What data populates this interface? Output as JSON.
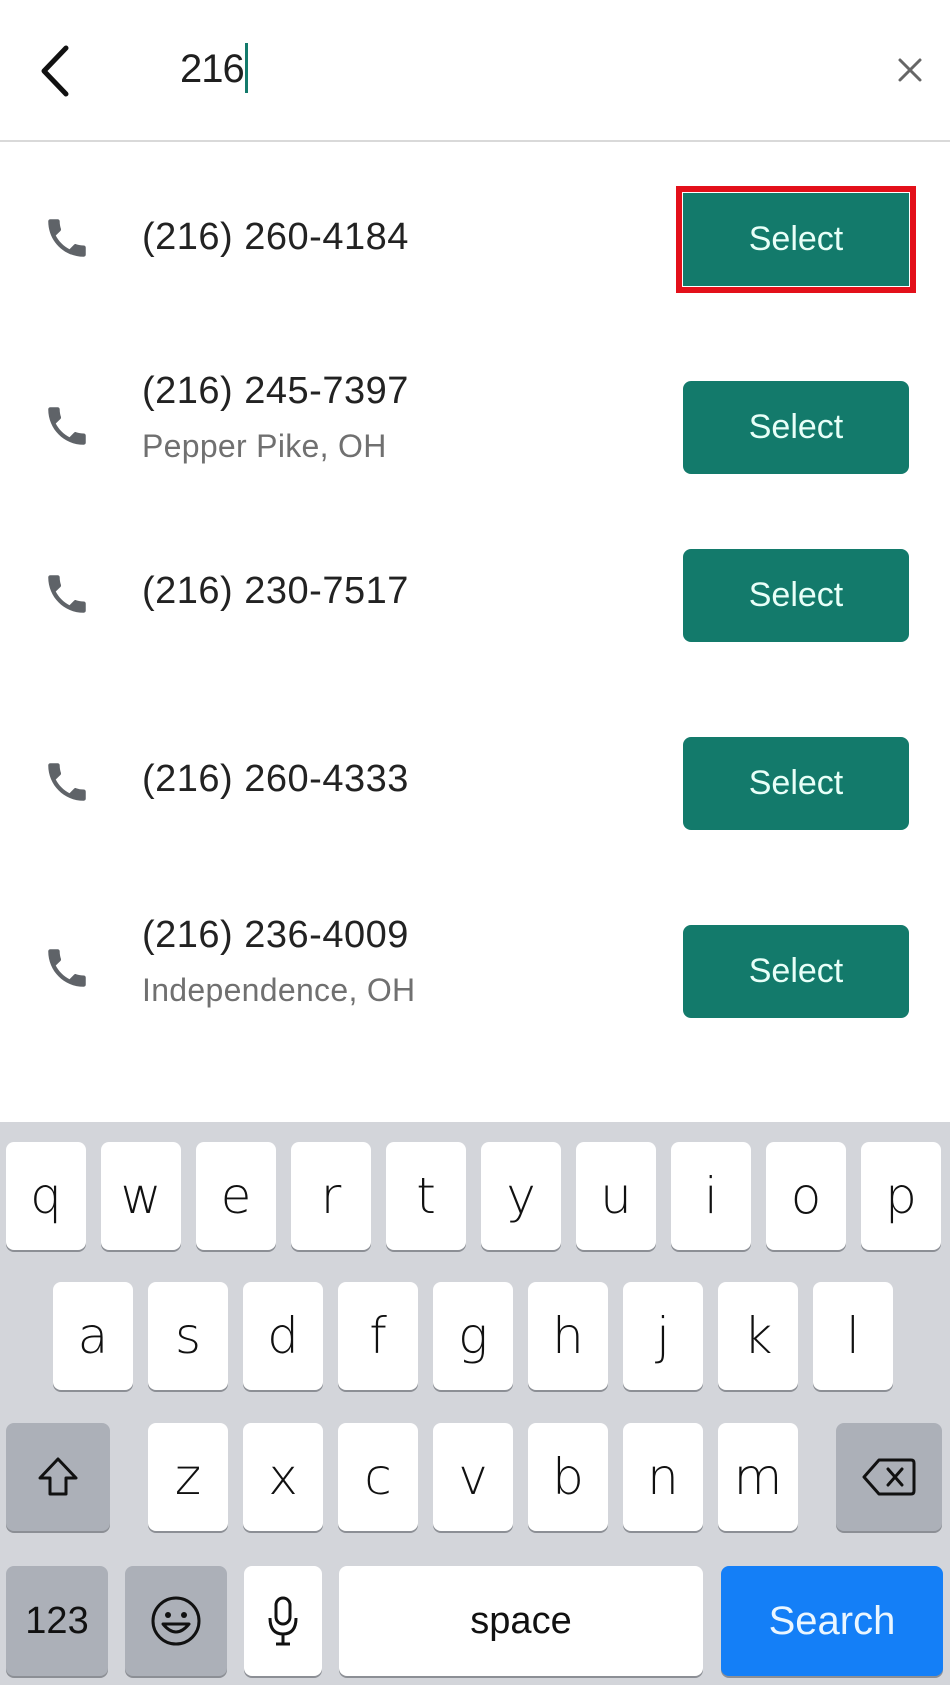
{
  "header": {
    "back_icon": "chevron-left-icon",
    "search_value": "216",
    "clear_icon": "close-icon"
  },
  "results": [
    {
      "number": "(216) 260-4184",
      "location": "",
      "button": "Select",
      "highlighted": true
    },
    {
      "number": "(216) 245-7397",
      "location": "Pepper Pike, OH",
      "button": "Select",
      "highlighted": false
    },
    {
      "number": "(216) 230-7517",
      "location": "",
      "button": "Select",
      "highlighted": false
    },
    {
      "number": "(216) 260-4333",
      "location": "",
      "button": "Select",
      "highlighted": false
    },
    {
      "number": "(216) 236-4009",
      "location": "Independence, OH",
      "button": "Select",
      "highlighted": false
    }
  ],
  "keyboard": {
    "row1": [
      "q",
      "w",
      "e",
      "r",
      "t",
      "y",
      "u",
      "i",
      "o",
      "p"
    ],
    "row2": [
      "a",
      "s",
      "d",
      "f",
      "g",
      "h",
      "j",
      "k",
      "l"
    ],
    "row3": [
      "z",
      "x",
      "c",
      "v",
      "b",
      "n",
      "m"
    ],
    "shift_icon": "shift-icon",
    "backspace_icon": "backspace-icon",
    "numbers_label": "123",
    "emoji_icon": "emoji-icon",
    "mic_icon": "microphone-icon",
    "space_label": "space",
    "search_label": "Search"
  },
  "colors": {
    "accent": "#137a6b",
    "highlight": "#e3101a",
    "search_key": "#147ff7"
  }
}
